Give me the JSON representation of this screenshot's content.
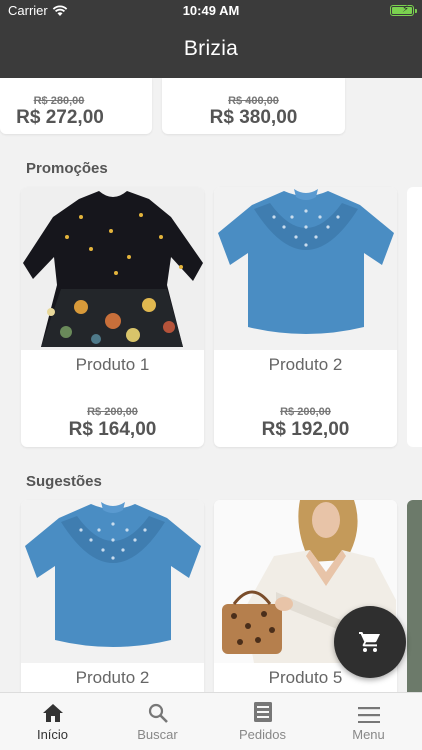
{
  "status": {
    "carrier": "Carrier",
    "time": "10:49 AM"
  },
  "app": {
    "title": "Brizia"
  },
  "top_cards": [
    {
      "old_price": "R$ 280,00",
      "new_price": "R$ 272,00"
    },
    {
      "old_price": "R$ 400,00",
      "new_price": "R$ 380,00"
    }
  ],
  "promocoes": {
    "title": "Promoções",
    "products": [
      {
        "name": "Produto 1",
        "old_price": "R$ 200,00",
        "new_price": "R$ 164,00"
      },
      {
        "name": "Produto 2",
        "old_price": "R$ 200,00",
        "new_price": "R$ 192,00"
      }
    ]
  },
  "sugestoes": {
    "title": "Sugestões",
    "products": [
      {
        "name": "Produto 2"
      },
      {
        "name": "Produto 5"
      }
    ]
  },
  "tabs": [
    {
      "label": "Início",
      "icon": "home-icon",
      "active": true
    },
    {
      "label": "Buscar",
      "icon": "search-icon"
    },
    {
      "label": "Pedidos",
      "icon": "orders-icon"
    },
    {
      "label": "Menu",
      "icon": "menu-icon"
    }
  ],
  "colors": {
    "header": "#3b3b3b",
    "background": "#f2f2f2",
    "fab": "#2f2f2f",
    "blouse_blue": "#4a8dc3"
  }
}
